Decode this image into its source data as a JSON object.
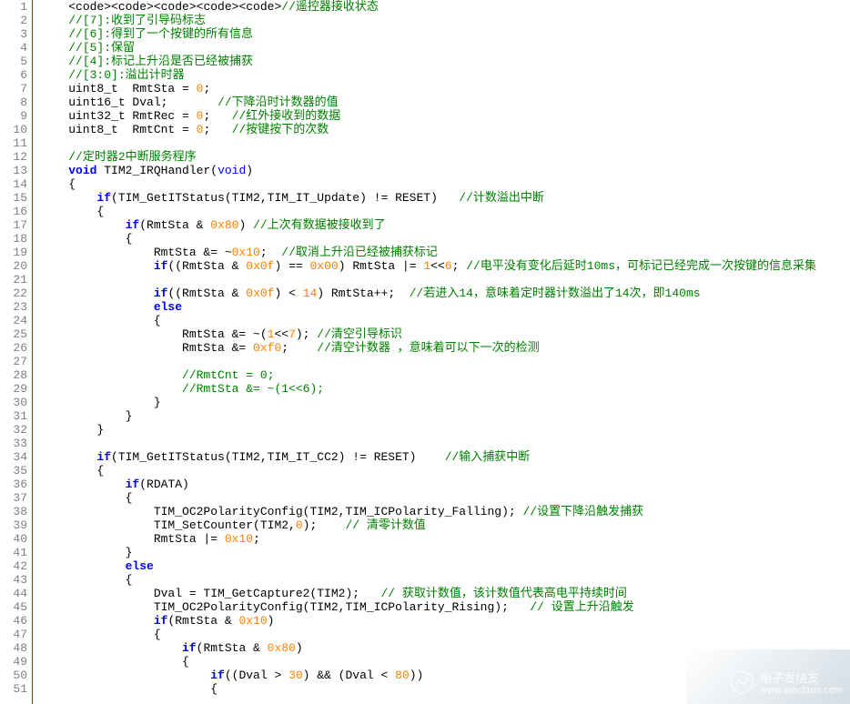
{
  "code": {
    "lines": [
      {
        "n": 1,
        "segs": [
          {
            "t": "    "
          },
          {
            "t": "<code><code><code><code><code>",
            "c": ""
          },
          {
            "t": "//遥控器接收状态",
            "c": "c-comment"
          }
        ]
      },
      {
        "n": 2,
        "segs": [
          {
            "t": "    "
          },
          {
            "t": "//[7]:收到了引导码标志",
            "c": "c-comment"
          }
        ]
      },
      {
        "n": 3,
        "segs": [
          {
            "t": "    "
          },
          {
            "t": "//[6]:得到了一个按键的所有信息",
            "c": "c-comment"
          }
        ]
      },
      {
        "n": 4,
        "segs": [
          {
            "t": "    "
          },
          {
            "t": "//[5]:保留",
            "c": "c-comment"
          }
        ]
      },
      {
        "n": 5,
        "segs": [
          {
            "t": "    "
          },
          {
            "t": "//[4]:标记上升沿是否已经被捕获",
            "c": "c-comment"
          }
        ]
      },
      {
        "n": 6,
        "segs": [
          {
            "t": "    "
          },
          {
            "t": "//[3:0]:溢出计时器",
            "c": "c-comment"
          }
        ]
      },
      {
        "n": 7,
        "segs": [
          {
            "t": "    uint8_t  RmtSta = "
          },
          {
            "t": "0",
            "c": "c-number"
          },
          {
            "t": ";"
          }
        ]
      },
      {
        "n": 8,
        "segs": [
          {
            "t": "    uint16_t Dval;       "
          },
          {
            "t": "//下降沿时计数器的值",
            "c": "c-comment"
          }
        ]
      },
      {
        "n": 9,
        "segs": [
          {
            "t": "    uint32_t RmtRec = "
          },
          {
            "t": "0",
            "c": "c-number"
          },
          {
            "t": ";   "
          },
          {
            "t": "//红外接收到的数据",
            "c": "c-comment"
          }
        ]
      },
      {
        "n": 10,
        "segs": [
          {
            "t": "    uint8_t  RmtCnt = "
          },
          {
            "t": "0",
            "c": "c-number"
          },
          {
            "t": ";   "
          },
          {
            "t": "//按键按下的次数",
            "c": "c-comment"
          }
        ]
      },
      {
        "n": 11,
        "segs": [
          {
            "t": ""
          }
        ]
      },
      {
        "n": 12,
        "segs": [
          {
            "t": "    "
          },
          {
            "t": "//定时器2中断服务程序",
            "c": "c-comment"
          }
        ]
      },
      {
        "n": 13,
        "segs": [
          {
            "t": "    "
          },
          {
            "t": "void",
            "c": "c-keyword-bold"
          },
          {
            "t": " TIM2_IRQHandler("
          },
          {
            "t": "void",
            "c": "c-keyword"
          },
          {
            "t": ")"
          }
        ]
      },
      {
        "n": 14,
        "segs": [
          {
            "t": "    {"
          }
        ]
      },
      {
        "n": 15,
        "segs": [
          {
            "t": "        "
          },
          {
            "t": "if",
            "c": "c-keyword-bold"
          },
          {
            "t": "(TIM_GetITStatus(TIM2,TIM_IT_Update) != RESET)   "
          },
          {
            "t": "//计数溢出中断",
            "c": "c-comment"
          }
        ]
      },
      {
        "n": 16,
        "segs": [
          {
            "t": "        {"
          }
        ]
      },
      {
        "n": 17,
        "segs": [
          {
            "t": "            "
          },
          {
            "t": "if",
            "c": "c-keyword-bold"
          },
          {
            "t": "(RmtSta & "
          },
          {
            "t": "0x80",
            "c": "c-number"
          },
          {
            "t": ") "
          },
          {
            "t": "//上次有数据被接收到了",
            "c": "c-comment"
          }
        ]
      },
      {
        "n": 18,
        "segs": [
          {
            "t": "            {"
          }
        ]
      },
      {
        "n": 19,
        "segs": [
          {
            "t": "                RmtSta &= ~"
          },
          {
            "t": "0x10",
            "c": "c-number"
          },
          {
            "t": ";  "
          },
          {
            "t": "//取消上升沿已经被捕获标记",
            "c": "c-comment"
          }
        ]
      },
      {
        "n": 20,
        "segs": [
          {
            "t": "                "
          },
          {
            "t": "if",
            "c": "c-keyword-bold"
          },
          {
            "t": "((RmtSta & "
          },
          {
            "t": "0x0f",
            "c": "c-number"
          },
          {
            "t": ") == "
          },
          {
            "t": "0x00",
            "c": "c-number"
          },
          {
            "t": ") RmtSta |= "
          },
          {
            "t": "1",
            "c": "c-number"
          },
          {
            "t": "<<"
          },
          {
            "t": "6",
            "c": "c-number"
          },
          {
            "t": "; "
          },
          {
            "t": "//电平没有变化后延时10ms，可标记已经完成一次按键的信息采集",
            "c": "c-comment"
          }
        ]
      },
      {
        "n": 21,
        "segs": [
          {
            "t": ""
          }
        ]
      },
      {
        "n": 22,
        "segs": [
          {
            "t": "                "
          },
          {
            "t": "if",
            "c": "c-keyword-bold"
          },
          {
            "t": "((RmtSta & "
          },
          {
            "t": "0x0f",
            "c": "c-number"
          },
          {
            "t": ") < "
          },
          {
            "t": "14",
            "c": "c-number"
          },
          {
            "t": ") RmtSta++;  "
          },
          {
            "t": "//若进入14，意味着定时器计数溢出了14次，即140ms",
            "c": "c-comment"
          }
        ]
      },
      {
        "n": 23,
        "segs": [
          {
            "t": "                "
          },
          {
            "t": "else",
            "c": "c-keyword-bold"
          }
        ]
      },
      {
        "n": 24,
        "segs": [
          {
            "t": "                {"
          }
        ]
      },
      {
        "n": 25,
        "segs": [
          {
            "t": "                    RmtSta &= ~("
          },
          {
            "t": "1",
            "c": "c-number"
          },
          {
            "t": "<<"
          },
          {
            "t": "7",
            "c": "c-number"
          },
          {
            "t": "); "
          },
          {
            "t": "//清空引导标识",
            "c": "c-comment"
          }
        ]
      },
      {
        "n": 26,
        "segs": [
          {
            "t": "                    RmtSta &= "
          },
          {
            "t": "0xf0",
            "c": "c-number"
          },
          {
            "t": ";    "
          },
          {
            "t": "//清空计数器 ，意味着可以下一次的检测",
            "c": "c-comment"
          }
        ]
      },
      {
        "n": 27,
        "segs": [
          {
            "t": ""
          }
        ]
      },
      {
        "n": 28,
        "segs": [
          {
            "t": "                    "
          },
          {
            "t": "//RmtCnt = 0;",
            "c": "c-comment"
          }
        ]
      },
      {
        "n": 29,
        "segs": [
          {
            "t": "                    "
          },
          {
            "t": "//RmtSta &= ~(1<<6);",
            "c": "c-comment"
          }
        ]
      },
      {
        "n": 30,
        "segs": [
          {
            "t": "                }"
          }
        ]
      },
      {
        "n": 31,
        "segs": [
          {
            "t": "            }"
          }
        ]
      },
      {
        "n": 32,
        "segs": [
          {
            "t": "        }"
          }
        ]
      },
      {
        "n": 33,
        "segs": [
          {
            "t": ""
          }
        ]
      },
      {
        "n": 34,
        "segs": [
          {
            "t": "        "
          },
          {
            "t": "if",
            "c": "c-keyword-bold"
          },
          {
            "t": "(TIM_GetITStatus(TIM2,TIM_IT_CC2) != RESET)    "
          },
          {
            "t": "//输入捕获中断",
            "c": "c-comment"
          }
        ]
      },
      {
        "n": 35,
        "segs": [
          {
            "t": "        {"
          }
        ]
      },
      {
        "n": 36,
        "segs": [
          {
            "t": "            "
          },
          {
            "t": "if",
            "c": "c-keyword-bold"
          },
          {
            "t": "(RDATA)"
          }
        ]
      },
      {
        "n": 37,
        "segs": [
          {
            "t": "            {"
          }
        ]
      },
      {
        "n": 38,
        "segs": [
          {
            "t": "                TIM_OC2PolarityConfig(TIM2,TIM_ICPolarity_Falling); "
          },
          {
            "t": "//设置下降沿触发捕获",
            "c": "c-comment"
          }
        ]
      },
      {
        "n": 39,
        "segs": [
          {
            "t": "                TIM_SetCounter(TIM2,"
          },
          {
            "t": "0",
            "c": "c-number"
          },
          {
            "t": ");    "
          },
          {
            "t": "// 清零计数值",
            "c": "c-comment"
          }
        ]
      },
      {
        "n": 40,
        "segs": [
          {
            "t": "                RmtSta |= "
          },
          {
            "t": "0x10",
            "c": "c-number"
          },
          {
            "t": ";"
          }
        ]
      },
      {
        "n": 41,
        "segs": [
          {
            "t": "            }"
          }
        ]
      },
      {
        "n": 42,
        "segs": [
          {
            "t": "            "
          },
          {
            "t": "else",
            "c": "c-keyword-bold"
          }
        ]
      },
      {
        "n": 43,
        "segs": [
          {
            "t": "            {"
          }
        ]
      },
      {
        "n": 44,
        "segs": [
          {
            "t": "                Dval = TIM_GetCapture2(TIM2);   "
          },
          {
            "t": "// 获取计数值，该计数值代表高电平持续时间",
            "c": "c-comment"
          }
        ]
      },
      {
        "n": 45,
        "segs": [
          {
            "t": "                TIM_OC2PolarityConfig(TIM2,TIM_ICPolarity_Rising);   "
          },
          {
            "t": "// 设置上升沿触发",
            "c": "c-comment"
          }
        ]
      },
      {
        "n": 46,
        "segs": [
          {
            "t": "                "
          },
          {
            "t": "if",
            "c": "c-keyword-bold"
          },
          {
            "t": "(RmtSta & "
          },
          {
            "t": "0x10",
            "c": "c-number"
          },
          {
            "t": ")"
          }
        ]
      },
      {
        "n": 47,
        "segs": [
          {
            "t": "                {"
          }
        ]
      },
      {
        "n": 48,
        "segs": [
          {
            "t": "                    "
          },
          {
            "t": "if",
            "c": "c-keyword-bold"
          },
          {
            "t": "(RmtSta & "
          },
          {
            "t": "0x80",
            "c": "c-number"
          },
          {
            "t": ")"
          }
        ]
      },
      {
        "n": 49,
        "segs": [
          {
            "t": "                    {"
          }
        ]
      },
      {
        "n": 50,
        "segs": [
          {
            "t": "                        "
          },
          {
            "t": "if",
            "c": "c-keyword-bold"
          },
          {
            "t": "((Dval > "
          },
          {
            "t": "30",
            "c": "c-number"
          },
          {
            "t": ") && (Dval < "
          },
          {
            "t": "80",
            "c": "c-number"
          },
          {
            "t": "))"
          }
        ]
      },
      {
        "n": 51,
        "segs": [
          {
            "t": "                        {"
          }
        ]
      }
    ]
  },
  "watermark": {
    "cn": "电子发烧友",
    "url": "www.elecfans.com"
  }
}
